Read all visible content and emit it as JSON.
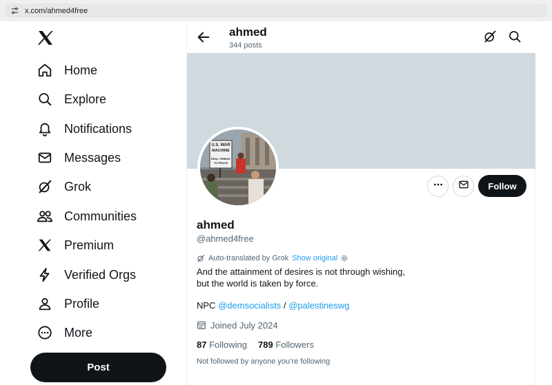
{
  "browser": {
    "url": "x.com/ahmed4free"
  },
  "sidebar": {
    "items": [
      {
        "label": "Home",
        "icon": "home-icon"
      },
      {
        "label": "Explore",
        "icon": "search-icon"
      },
      {
        "label": "Notifications",
        "icon": "bell-icon"
      },
      {
        "label": "Messages",
        "icon": "envelope-icon"
      },
      {
        "label": "Grok",
        "icon": "grok-icon"
      },
      {
        "label": "Communities",
        "icon": "people-icon"
      },
      {
        "label": "Premium",
        "icon": "x-logo-icon"
      },
      {
        "label": "Verified Orgs",
        "icon": "lightning-icon"
      },
      {
        "label": "Profile",
        "icon": "person-icon"
      },
      {
        "label": "More",
        "icon": "more-circle-icon"
      }
    ],
    "post_label": "Post"
  },
  "header": {
    "name": "ahmed",
    "posts": "344 posts"
  },
  "profile": {
    "follow_label": "Follow",
    "name": "ahmed",
    "handle": "@ahmed4free",
    "translated_note": "Auto-translated by Grok",
    "show_original": "Show original",
    "bio_line1": "And the attainment of desires is not through wishing,",
    "bio_line2": "but the world is taken by force.",
    "npc_prefix": "NPC",
    "link1": "@demsocialists",
    "separator": "/",
    "link2": "@palestineswg",
    "joined": "Joined July 2024",
    "following_count": "87",
    "following_label": "Following",
    "followers_count": "789",
    "followers_label": "Followers",
    "not_followed": "Not followed by anyone you’re following"
  },
  "avatar_sign": {
    "line1": "U.S. WAR",
    "line2": "MACHINE",
    "line3": "REAL THREAT",
    "line4": "TO PEACE"
  },
  "colors": {
    "accent": "#1d9bf0",
    "banner": "#cfd9de",
    "text": "#0f1419",
    "muted": "#536471"
  }
}
